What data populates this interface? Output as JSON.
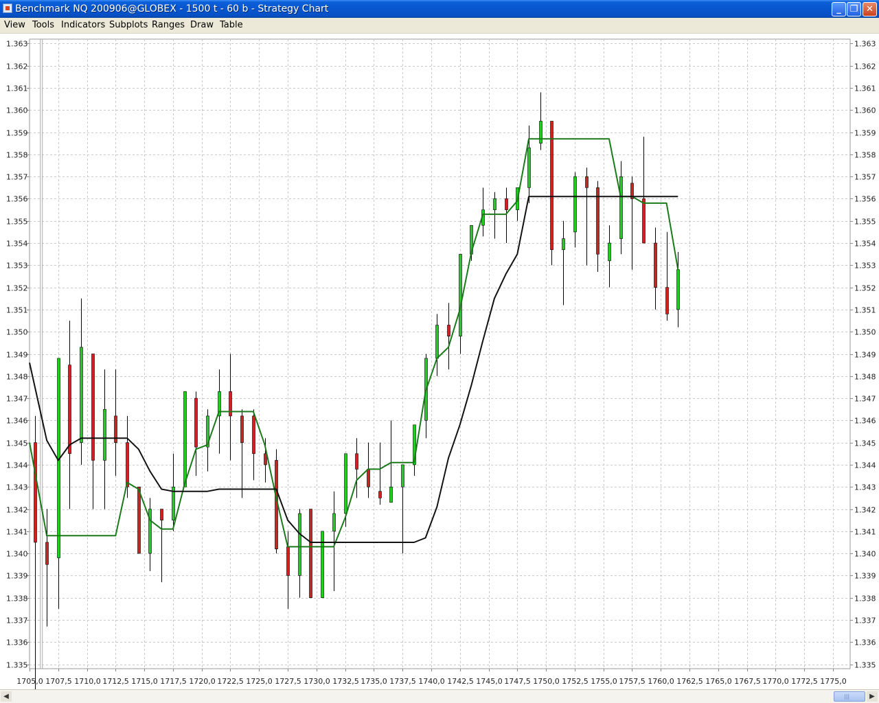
{
  "window": {
    "title": "Benchmark NQ 200906@GLOBEX - 1500 t - 60 b - Strategy Chart",
    "controls": [
      "minimize",
      "maximize",
      "close"
    ]
  },
  "menu": {
    "items": [
      "View",
      "Tools",
      "Indicators",
      "Subplots",
      "Ranges",
      "Draw",
      "Table"
    ]
  },
  "chart_data": {
    "type": "candlestick",
    "grid": true,
    "y_axis": {
      "range": [
        1.3348,
        1.3632
      ],
      "ticks": [
        "1.335",
        "1.336",
        "1.337",
        "1.338",
        "1.339",
        "1.340",
        "1.341",
        "1.342",
        "1.343",
        "1.344",
        "1.345",
        "1.346",
        "1.347",
        "1.348",
        "1.349",
        "1.350",
        "1.351",
        "1.352",
        "1.353",
        "1.354",
        "1.355",
        "1.356",
        "1.357",
        "1.358",
        "1.359",
        "1.360",
        "1.361",
        "1.362",
        "1.363"
      ],
      "labels_on": [
        "left",
        "right"
      ]
    },
    "x_axis": {
      "range": [
        1705.0,
        1776.5
      ],
      "ticks": [
        1705.0,
        1707.5,
        1710.0,
        1712.5,
        1715.0,
        1717.5,
        1720.0,
        1722.5,
        1725.0,
        1727.5,
        1730.0,
        1732.5,
        1735.0,
        1737.5,
        1740.0,
        1742.5,
        1745.0,
        1747.5,
        1750.0,
        1752.5,
        1755.0,
        1757.5,
        1760.0,
        1762.5,
        1765.0,
        1767.5,
        1770.0,
        1772.5,
        1775.0
      ],
      "tick_labels": [
        "1705,0",
        "1707,5",
        "1710,0",
        "1712,5",
        "1715,0",
        "1717,5",
        "1720,0",
        "1722,5",
        "1725,0",
        "1727,5",
        "1730,0",
        "1732,5",
        "1735,0",
        "1737,5",
        "1740,0",
        "1742,5",
        "1745,0",
        "1747,5",
        "1750,0",
        "1752,5",
        "1755,0",
        "1757,5",
        "1760,0",
        "1762,5",
        "1765,0",
        "1767,5",
        "1770,0",
        "1772,5",
        "1775,0"
      ]
    },
    "marker_line_x": 1706.0,
    "up_color": "#22cc22",
    "down_color": "#cc2222",
    "candles": [
      {
        "x": 1705.5,
        "o": 1.345,
        "h": 1.3462,
        "l": 1.3335,
        "c": 1.3405
      },
      {
        "x": 1706.5,
        "o": 1.3405,
        "h": 1.342,
        "l": 1.3367,
        "c": 1.3395
      },
      {
        "x": 1707.5,
        "o": 1.3398,
        "h": 1.3488,
        "l": 1.3375,
        "c": 1.3488
      },
      {
        "x": 1708.5,
        "o": 1.3485,
        "h": 1.3505,
        "l": 1.342,
        "c": 1.3445
      },
      {
        "x": 1709.5,
        "o": 1.345,
        "h": 1.3515,
        "l": 1.344,
        "c": 1.3493
      },
      {
        "x": 1710.5,
        "o": 1.349,
        "h": 1.349,
        "l": 1.342,
        "c": 1.3442
      },
      {
        "x": 1711.5,
        "o": 1.3442,
        "h": 1.3483,
        "l": 1.342,
        "c": 1.3465
      },
      {
        "x": 1712.5,
        "o": 1.3462,
        "h": 1.3483,
        "l": 1.3435,
        "c": 1.345
      },
      {
        "x": 1713.5,
        "o": 1.345,
        "h": 1.3462,
        "l": 1.3425,
        "c": 1.343
      },
      {
        "x": 1714.5,
        "o": 1.343,
        "h": 1.343,
        "l": 1.34,
        "c": 1.34
      },
      {
        "x": 1715.5,
        "o": 1.34,
        "h": 1.3425,
        "l": 1.3392,
        "c": 1.342
      },
      {
        "x": 1716.5,
        "o": 1.342,
        "h": 1.342,
        "l": 1.3387,
        "c": 1.3415
      },
      {
        "x": 1717.5,
        "o": 1.3415,
        "h": 1.3445,
        "l": 1.341,
        "c": 1.343
      },
      {
        "x": 1718.5,
        "o": 1.343,
        "h": 1.3473,
        "l": 1.343,
        "c": 1.3473
      },
      {
        "x": 1719.5,
        "o": 1.347,
        "h": 1.3473,
        "l": 1.3435,
        "c": 1.3448
      },
      {
        "x": 1720.5,
        "o": 1.3448,
        "h": 1.3465,
        "l": 1.3437,
        "c": 1.3462
      },
      {
        "x": 1721.5,
        "o": 1.3462,
        "h": 1.3483,
        "l": 1.3445,
        "c": 1.3473
      },
      {
        "x": 1722.5,
        "o": 1.3473,
        "h": 1.349,
        "l": 1.3442,
        "c": 1.3462
      },
      {
        "x": 1723.5,
        "o": 1.3462,
        "h": 1.3465,
        "l": 1.3425,
        "c": 1.345
      },
      {
        "x": 1724.5,
        "o": 1.3462,
        "h": 1.3465,
        "l": 1.3433,
        "c": 1.3445
      },
      {
        "x": 1725.5,
        "o": 1.3445,
        "h": 1.3452,
        "l": 1.3432,
        "c": 1.344
      },
      {
        "x": 1726.5,
        "o": 1.3442,
        "h": 1.3447,
        "l": 1.34,
        "c": 1.3402
      },
      {
        "x": 1727.5,
        "o": 1.3403,
        "h": 1.341,
        "l": 1.3375,
        "c": 1.339
      },
      {
        "x": 1728.5,
        "o": 1.339,
        "h": 1.342,
        "l": 1.338,
        "c": 1.3418
      },
      {
        "x": 1729.5,
        "o": 1.342,
        "h": 1.342,
        "l": 1.338,
        "c": 1.338
      },
      {
        "x": 1730.5,
        "o": 1.338,
        "h": 1.341,
        "l": 1.338,
        "c": 1.341
      },
      {
        "x": 1731.5,
        "o": 1.341,
        "h": 1.3428,
        "l": 1.3383,
        "c": 1.3418
      },
      {
        "x": 1732.5,
        "o": 1.3418,
        "h": 1.3445,
        "l": 1.3412,
        "c": 1.3445
      },
      {
        "x": 1733.5,
        "o": 1.3445,
        "h": 1.3452,
        "l": 1.3425,
        "c": 1.3438
      },
      {
        "x": 1734.5,
        "o": 1.3438,
        "h": 1.345,
        "l": 1.3425,
        "c": 1.343
      },
      {
        "x": 1735.5,
        "o": 1.3428,
        "h": 1.345,
        "l": 1.3422,
        "c": 1.3425
      },
      {
        "x": 1736.5,
        "o": 1.3423,
        "h": 1.346,
        "l": 1.3423,
        "c": 1.343
      },
      {
        "x": 1737.5,
        "o": 1.343,
        "h": 1.344,
        "l": 1.34,
        "c": 1.344
      },
      {
        "x": 1738.5,
        "o": 1.344,
        "h": 1.3458,
        "l": 1.3435,
        "c": 1.3458
      },
      {
        "x": 1739.5,
        "o": 1.346,
        "h": 1.349,
        "l": 1.3452,
        "c": 1.3488
      },
      {
        "x": 1740.5,
        "o": 1.3488,
        "h": 1.3508,
        "l": 1.348,
        "c": 1.3503
      },
      {
        "x": 1741.5,
        "o": 1.3503,
        "h": 1.3513,
        "l": 1.3483,
        "c": 1.3498
      },
      {
        "x": 1742.5,
        "o": 1.3498,
        "h": 1.3522,
        "l": 1.349,
        "c": 1.3535
      },
      {
        "x": 1743.5,
        "o": 1.3535,
        "h": 1.3548,
        "l": 1.3532,
        "c": 1.3548
      },
      {
        "x": 1744.5,
        "o": 1.3548,
        "h": 1.3565,
        "l": 1.3543,
        "c": 1.3555
      },
      {
        "x": 1745.5,
        "o": 1.3555,
        "h": 1.3563,
        "l": 1.3542,
        "c": 1.356
      },
      {
        "x": 1746.5,
        "o": 1.356,
        "h": 1.3565,
        "l": 1.354,
        "c": 1.3555
      },
      {
        "x": 1747.5,
        "o": 1.3555,
        "h": 1.3565,
        "l": 1.355,
        "c": 1.3565
      },
      {
        "x": 1748.5,
        "o": 1.3565,
        "h": 1.3593,
        "l": 1.3558,
        "c": 1.3583
      },
      {
        "x": 1749.5,
        "o": 1.3585,
        "h": 1.3608,
        "l": 1.3582,
        "c": 1.3595
      },
      {
        "x": 1750.5,
        "o": 1.3595,
        "h": 1.3595,
        "l": 1.353,
        "c": 1.3537
      },
      {
        "x": 1751.5,
        "o": 1.3537,
        "h": 1.355,
        "l": 1.3512,
        "c": 1.3542
      },
      {
        "x": 1752.5,
        "o": 1.3545,
        "h": 1.3572,
        "l": 1.3538,
        "c": 1.357
      },
      {
        "x": 1753.5,
        "o": 1.357,
        "h": 1.3574,
        "l": 1.353,
        "c": 1.3565
      },
      {
        "x": 1754.5,
        "o": 1.3565,
        "h": 1.3568,
        "l": 1.3527,
        "c": 1.3535
      },
      {
        "x": 1755.5,
        "o": 1.3532,
        "h": 1.3548,
        "l": 1.352,
        "c": 1.354
      },
      {
        "x": 1756.5,
        "o": 1.3542,
        "h": 1.3577,
        "l": 1.3535,
        "c": 1.357
      },
      {
        "x": 1757.5,
        "o": 1.3567,
        "h": 1.357,
        "l": 1.3528,
        "c": 1.356
      },
      {
        "x": 1758.5,
        "o": 1.356,
        "h": 1.3588,
        "l": 1.354,
        "c": 1.354
      },
      {
        "x": 1759.5,
        "o": 1.354,
        "h": 1.3547,
        "l": 1.351,
        "c": 1.352
      },
      {
        "x": 1760.5,
        "o": 1.352,
        "h": 1.3545,
        "l": 1.3505,
        "c": 1.3508
      },
      {
        "x": 1761.5,
        "o": 1.351,
        "h": 1.3536,
        "l": 1.3502,
        "c": 1.3528
      }
    ],
    "series": [
      {
        "color": "#1a7a1a",
        "x": [
          1705.0,
          1706.5,
          1707.5,
          1708.5,
          1709.5,
          1710.5,
          1711.5,
          1712.5,
          1713.5,
          1714.5,
          1715.5,
          1716.5,
          1717.5,
          1718.5,
          1719.5,
          1720.5,
          1721.5,
          1722.5,
          1723.5,
          1724.5,
          1725.5,
          1726.5,
          1727.5,
          1728.5,
          1729.5,
          1730.5,
          1731.5,
          1732.5,
          1733.5,
          1734.5,
          1735.5,
          1736.5,
          1737.5,
          1738.5,
          1739.5,
          1740.5,
          1741.5,
          1742.5,
          1743.5,
          1744.5,
          1745.5,
          1746.5,
          1747.5,
          1748.5,
          1749.5,
          1750.5,
          1751.5,
          1752.5,
          1753.5,
          1754.5,
          1755.5,
          1756.5,
          1757.5,
          1758.5,
          1759.5,
          1760.5,
          1761.5
        ],
        "y": [
          1.345,
          1.3408,
          1.3408,
          1.3408,
          1.3408,
          1.3408,
          1.3408,
          1.3408,
          1.3432,
          1.3429,
          1.3415,
          1.3411,
          1.3411,
          1.3431,
          1.3447,
          1.3449,
          1.3464,
          1.3464,
          1.3464,
          1.3464,
          1.3449,
          1.3425,
          1.3403,
          1.3403,
          1.3403,
          1.3403,
          1.3403,
          1.3416,
          1.3433,
          1.3438,
          1.3438,
          1.3441,
          1.3441,
          1.3441,
          1.3473,
          1.3488,
          1.3493,
          1.351,
          1.3536,
          1.3553,
          1.3553,
          1.3553,
          1.3559,
          1.3587,
          1.3587,
          1.3587,
          1.3587,
          1.3587,
          1.3587,
          1.3587,
          1.3587,
          1.3561,
          1.3561,
          1.3558,
          1.3558,
          1.3558,
          1.3528
        ]
      },
      {
        "color": "#111111",
        "x": [
          1705.0,
          1706.5,
          1707.5,
          1708.5,
          1709.5,
          1710.5,
          1711.5,
          1712.5,
          1713.5,
          1714.5,
          1715.5,
          1716.5,
          1717.5,
          1718.5,
          1719.5,
          1720.5,
          1721.5,
          1722.5,
          1723.5,
          1724.5,
          1725.5,
          1726.5,
          1727.5,
          1728.5,
          1729.5,
          1730.5,
          1731.5,
          1732.5,
          1733.5,
          1734.5,
          1735.5,
          1736.5,
          1737.5,
          1738.5,
          1739.5,
          1740.5,
          1741.5,
          1742.5,
          1743.5,
          1744.5,
          1745.5,
          1746.5,
          1747.5,
          1748.5,
          1749.5,
          1750.5,
          1751.5,
          1752.5,
          1753.5,
          1754.5,
          1755.5,
          1756.5,
          1757.5,
          1758.5,
          1759.5,
          1760.5,
          1761.5
        ],
        "y": [
          1.3486,
          1.3451,
          1.3442,
          1.3449,
          1.3452,
          1.3452,
          1.3452,
          1.3452,
          1.3452,
          1.3447,
          1.3437,
          1.3429,
          1.3428,
          1.3428,
          1.3428,
          1.3428,
          1.3429,
          1.3429,
          1.3429,
          1.3429,
          1.3429,
          1.3429,
          1.3415,
          1.3409,
          1.3405,
          1.3405,
          1.3405,
          1.3405,
          1.3405,
          1.3405,
          1.3405,
          1.3405,
          1.3405,
          1.3405,
          1.3407,
          1.3421,
          1.3443,
          1.3458,
          1.3476,
          1.3496,
          1.3515,
          1.3526,
          1.3535,
          1.3561,
          1.3561,
          1.3561,
          1.3561,
          1.3561,
          1.3561,
          1.3561,
          1.3561,
          1.3561,
          1.3561,
          1.3561,
          1.3561,
          1.3561,
          1.3561
        ]
      }
    ]
  }
}
